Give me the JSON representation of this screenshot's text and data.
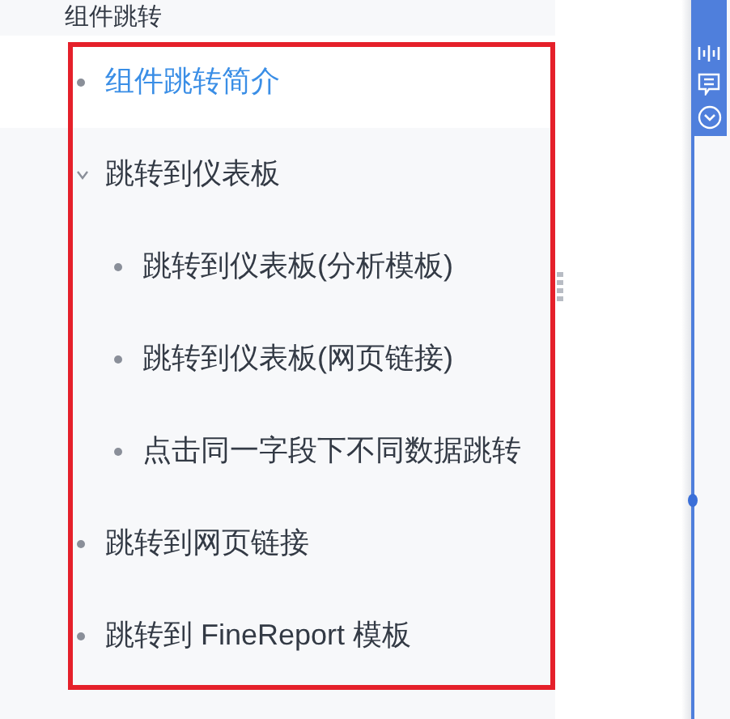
{
  "parent_item": {
    "label": "组件跳转"
  },
  "tree": [
    {
      "label": "组件跳转简介",
      "selected": true
    },
    {
      "label": "跳转到仪表板",
      "selected": false,
      "expanded": true,
      "children": [
        {
          "label": "跳转到仪表板(分析模板)",
          "selected": false
        },
        {
          "label": "跳转到仪表板(网页链接)",
          "selected": false
        },
        {
          "label": "点击同一字段下不同数据跳转",
          "selected": false
        }
      ]
    },
    {
      "label": "跳转到网页链接",
      "selected": false
    },
    {
      "label": "跳转到 FineReport 模板",
      "selected": false
    }
  ]
}
